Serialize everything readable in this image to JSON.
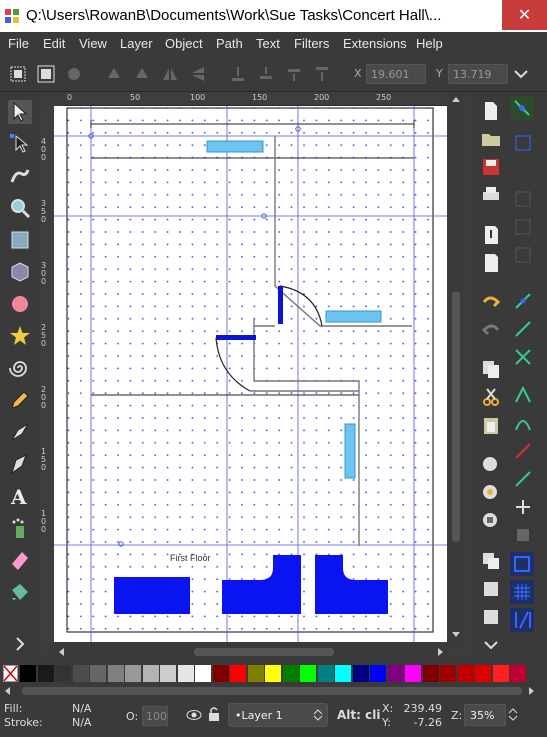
{
  "window": {
    "title": "Q:\\Users\\RowanB\\Documents\\Work\\Sue Tasks\\Concert Hall\\...",
    "close_glyph": "✕"
  },
  "menu": [
    "File",
    "Edit",
    "View",
    "Layer",
    "Object",
    "Path",
    "Text",
    "Filters",
    "Extensions",
    "Help"
  ],
  "toolbar": {
    "x_label": "X",
    "x_value": "19.601",
    "y_label": "Y",
    "y_value": "13.719"
  },
  "ruler": {
    "h_ticks": [
      "0",
      "50",
      "100",
      "150",
      "200",
      "250"
    ],
    "v_ticks": [
      "4\n0\n0",
      "3\n5\n0",
      "3\n0\n0",
      "2\n5\n0",
      "2\n0\n0",
      "1\n5\n0",
      "1\n0\n0"
    ]
  },
  "canvas": {
    "floor_label": "First Floor"
  },
  "palette": {
    "colors": [
      "#000000",
      "#1a1a1a",
      "#333333",
      "#4d4d4d",
      "#666666",
      "#808080",
      "#999999",
      "#b3b3b3",
      "#cccccc",
      "#e6e6e6",
      "#ffffff",
      "#800000",
      "#ff0000",
      "#808000",
      "#ffff00",
      "#008000",
      "#00ff00",
      "#008080",
      "#00ffff",
      "#000080",
      "#0000ff",
      "#800080",
      "#ff00ff",
      "#800000",
      "#a00000",
      "#c00000",
      "#e00000",
      "#ff2020",
      "#c00030"
    ]
  },
  "status": {
    "fill_label": "Fill:",
    "fill_value": "N/A",
    "stroke_label": "Stroke:",
    "stroke_value": "N/A",
    "opacity_label": "O:",
    "opacity_value": "100",
    "layer_value": "•Layer 1",
    "message": "Alt: cli",
    "x_label": "X:",
    "x_value": "239.49",
    "y_label": "Y:",
    "y_value": "-7.26",
    "zoom_label": "Z:",
    "zoom_value": "35%"
  }
}
